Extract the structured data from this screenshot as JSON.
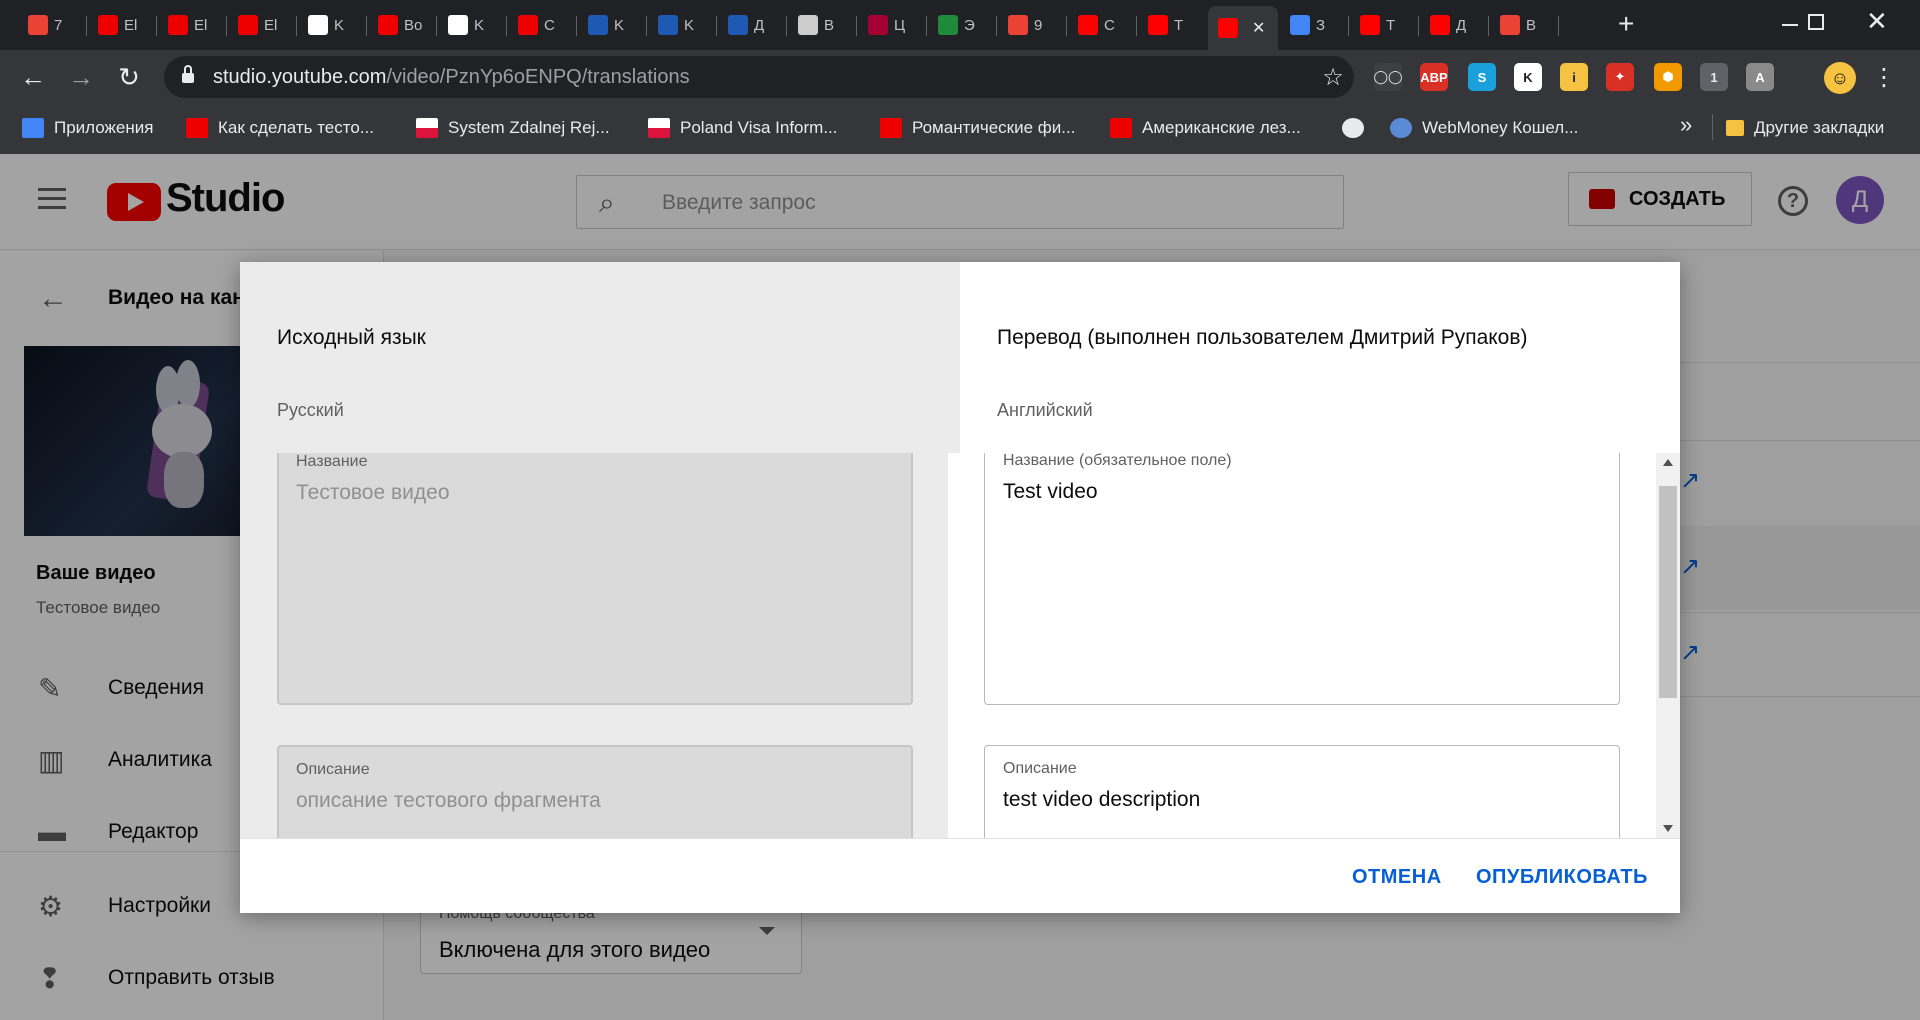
{
  "browser": {
    "tabs": [
      {
        "title": "7",
        "favicon": "gmail-icon",
        "color": "#ea4335"
      },
      {
        "title": "El",
        "favicon": "ivi-icon",
        "color": "#e00"
      },
      {
        "title": "El",
        "favicon": "ivi-icon",
        "color": "#e00"
      },
      {
        "title": "El",
        "favicon": "ivi-icon",
        "color": "#e00"
      },
      {
        "title": "K",
        "favicon": "ma-icon",
        "color": "#fff"
      },
      {
        "title": "Bo",
        "favicon": "ivi-icon",
        "color": "#e00"
      },
      {
        "title": "K",
        "favicon": "octopus-icon",
        "color": "#fff"
      },
      {
        "title": "C",
        "favicon": "ivi-icon",
        "color": "#e00"
      },
      {
        "title": "K",
        "favicon": "drops-icon",
        "color": "#1e5ab4"
      },
      {
        "title": "K",
        "favicon": "drops-icon",
        "color": "#1e5ab4"
      },
      {
        "title": "Д",
        "favicon": "drops-icon",
        "color": "#1e5ab4"
      },
      {
        "title": "В",
        "favicon": "ip-icon",
        "color": "#ccc"
      },
      {
        "title": "Ц",
        "favicon": "lg-icon",
        "color": "#a50034"
      },
      {
        "title": "Э",
        "favicon": "cross-icon",
        "color": "#1f8b3a"
      },
      {
        "title": "9",
        "favicon": "gmail-icon",
        "color": "#ea4335"
      },
      {
        "title": "С",
        "favicon": "youtube-icon",
        "color": "#f00"
      },
      {
        "title": "Т",
        "favicon": "youtube-icon",
        "color": "#f00"
      },
      {
        "title": "",
        "favicon": "youtube-icon",
        "color": "#f00",
        "active": true
      },
      {
        "title": "З",
        "favicon": "google-icon",
        "color": "#4285f4"
      },
      {
        "title": "Т",
        "favicon": "youtube-icon",
        "color": "#f00"
      },
      {
        "title": "Д",
        "favicon": "youtube-icon",
        "color": "#f00"
      },
      {
        "title": "В",
        "favicon": "gmail-icon",
        "color": "#ea4335"
      }
    ],
    "url": {
      "host": "studio.youtube.com",
      "path": "/video/PznYp6oENPQ/translations"
    },
    "bookmarks": [
      {
        "label": "Приложения",
        "icon": "apps-icon"
      },
      {
        "label": "Как сделать тесто...",
        "icon": "check-icon"
      },
      {
        "label": "System Zdalnej Rej...",
        "icon": "flag-pl-icon"
      },
      {
        "label": "Poland Visa Inform...",
        "icon": "flag-pl-icon"
      },
      {
        "label": "Романтические фи...",
        "icon": "ivi-icon"
      },
      {
        "label": "Американские лез...",
        "icon": "ivi-icon"
      },
      {
        "label": "",
        "icon": "globe-icon"
      },
      {
        "label": "WebMoney Кошел...",
        "icon": "webmoney-icon"
      }
    ],
    "bookmarks_more": "»",
    "other_bookmarks": "Другие закладки",
    "extensions": [
      "ABP",
      "S",
      "K",
      "i",
      "1",
      "A"
    ]
  },
  "studio": {
    "brand": "Studio",
    "search_placeholder": "Введите запрос",
    "create_label": "СОЗДАТЬ",
    "avatar_letter": "Д",
    "back_label": "Видео на кан",
    "your_video_label": "Ваше видео",
    "video_title": "Тестовое видео",
    "nav": [
      {
        "label": "Сведения",
        "icon": "pencil-icon"
      },
      {
        "label": "Аналитика",
        "icon": "analytics-icon"
      },
      {
        "label": "Редактор",
        "icon": "clapper-icon"
      },
      {
        "label": "Настройки",
        "icon": "gear-icon"
      },
      {
        "label": "Отправить отзыв",
        "icon": "feedback-icon"
      }
    ],
    "community_label": "Помощь сообщества",
    "community_value": "Включена для этого видео"
  },
  "dialog": {
    "source_header": "Исходный язык",
    "source_language": "Русский",
    "target_header": "Перевод (выполнен пользователем Дмитрий Рупаков)",
    "target_language": "Английский",
    "source_fields": [
      {
        "label": "Название",
        "value": "Тестовое видео"
      },
      {
        "label": "Описание",
        "value": "описание тестового фрагмента"
      }
    ],
    "target_fields": [
      {
        "label": "Название (обязательное поле)",
        "value": "Test video"
      },
      {
        "label": "Описание",
        "value": "test video description"
      }
    ],
    "cancel_label": "ОТМЕНА",
    "publish_label": "ОПУБЛИКОВАТЬ"
  }
}
